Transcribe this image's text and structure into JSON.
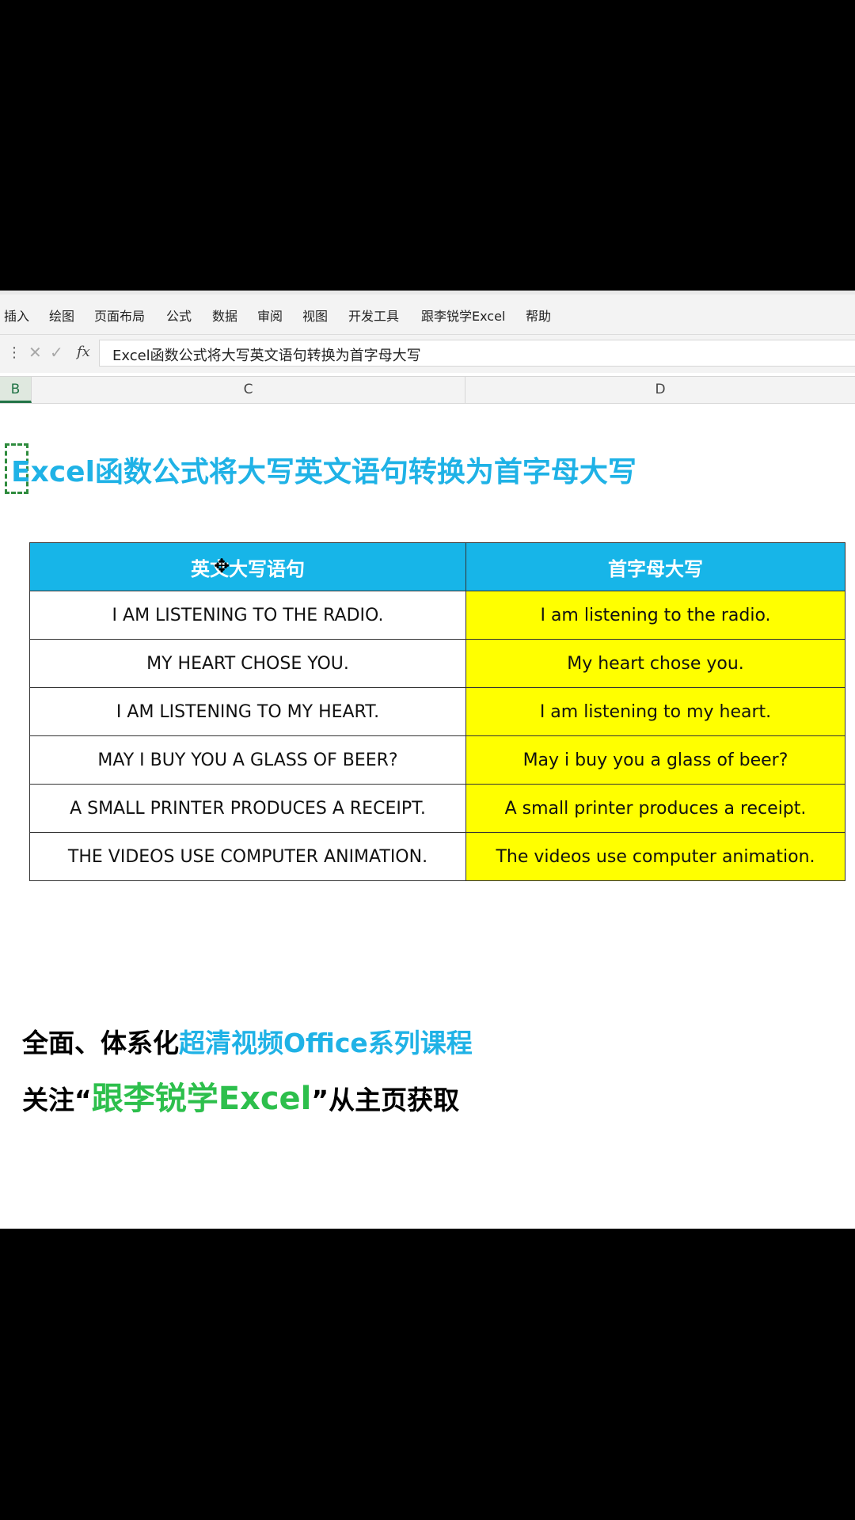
{
  "ribbon": {
    "menu": [
      "插入",
      "绘图",
      "页面布局",
      "公式",
      "数据",
      "审阅",
      "视图",
      "开发工具",
      "跟李锐学Excel",
      "帮助"
    ]
  },
  "formula_bar": {
    "cancel_glyph": "✕",
    "confirm_glyph": "✓",
    "fx_label": "fx",
    "content": "Excel函数公式将大写英文语句转换为首字母大写"
  },
  "columns": [
    "B",
    "C",
    "D"
  ],
  "sheet": {
    "title": "Excel函数公式将大写英文语句转换为首字母大写",
    "table": {
      "headers": [
        "英文大写语句",
        "首字母大写"
      ],
      "rows": [
        [
          "I AM LISTENING TO THE RADIO.",
          "I am listening to the radio."
        ],
        [
          "MY HEART CHOSE YOU.",
          "My heart chose you."
        ],
        [
          "I AM LISTENING TO MY HEART.",
          "I am listening to my heart."
        ],
        [
          "MAY I BUY YOU A GLASS OF BEER?",
          "May i buy you a glass of beer?"
        ],
        [
          "A SMALL PRINTER PRODUCES A RECEIPT.",
          "A small printer produces a receipt."
        ],
        [
          "THE VIDEOS USE COMPUTER ANIMATION.",
          "The videos use computer animation."
        ]
      ]
    }
  },
  "promo": {
    "line1_prefix": "全面、体系化",
    "line1_highlight": "超清视频Office系列课程",
    "line2_prefix": "关注“",
    "line2_highlight": "跟李锐学Excel",
    "line2_suffix": "”从主页获取"
  },
  "colors": {
    "header_blue": "#17b5e8",
    "title_blue": "#1fb2e6",
    "highlight_yellow": "#ffff00",
    "promo_green": "#2dbf4c",
    "selection_green": "#2e8b3d"
  },
  "icons": {
    "cursor": "move-cursor-icon"
  }
}
